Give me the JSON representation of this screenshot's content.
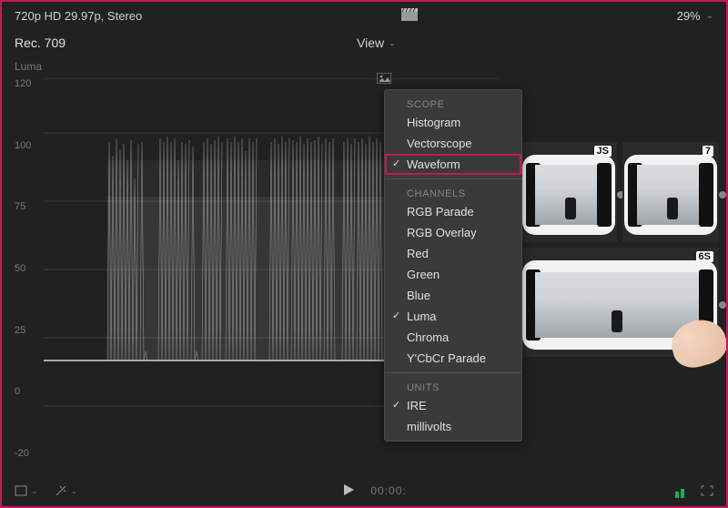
{
  "topbar": {
    "format": "720p HD 29.97p, Stereo",
    "zoom": "29%"
  },
  "infobar": {
    "colorspace": "Rec. 709",
    "view_label": "View"
  },
  "scope_title": "Luma",
  "yaxis_ticks": [
    "120",
    "100",
    "75",
    "50",
    "25",
    "0",
    "-20"
  ],
  "menu": {
    "sections": [
      {
        "header": "SCOPE",
        "items": [
          {
            "label": "Histogram",
            "selected": false,
            "highlight": false
          },
          {
            "label": "Vectorscope",
            "selected": false,
            "highlight": false
          },
          {
            "label": "Waveform",
            "selected": true,
            "highlight": true
          }
        ]
      },
      {
        "header": "CHANNELS",
        "items": [
          {
            "label": "RGB Parade",
            "selected": false
          },
          {
            "label": "RGB Overlay",
            "selected": false
          },
          {
            "label": "Red",
            "selected": false
          },
          {
            "label": "Green",
            "selected": false
          },
          {
            "label": "Blue",
            "selected": false
          },
          {
            "label": "Luma",
            "selected": true
          },
          {
            "label": "Chroma",
            "selected": false
          },
          {
            "label": "Y'CbCr Parade",
            "selected": false
          }
        ]
      },
      {
        "header": "UNITS",
        "items": [
          {
            "label": "IRE",
            "selected": true
          },
          {
            "label": "millivolts",
            "selected": false
          }
        ]
      }
    ]
  },
  "clips": [
    {
      "tag": "JS"
    },
    {
      "tag": "7"
    },
    {
      "tag": "6S"
    }
  ],
  "transport": {
    "timecode": "00:00:"
  }
}
